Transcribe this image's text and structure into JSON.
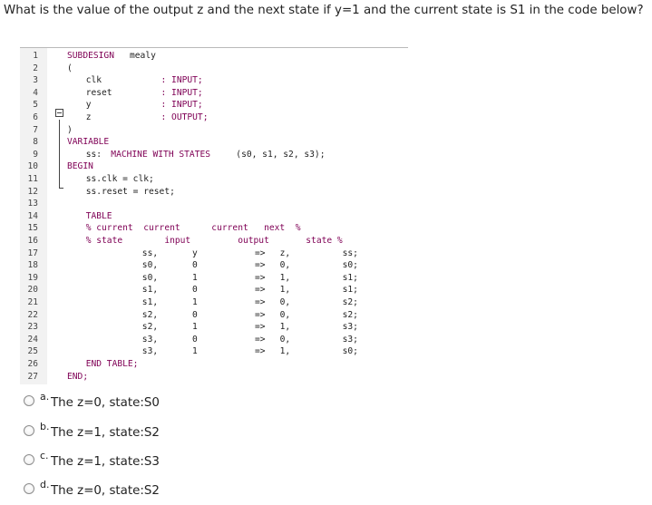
{
  "question": "What is the value of the output z and the next state if y=1 and the current state is S1 in the code below?",
  "code_lines": [
    {
      "no": "1",
      "tokens": [
        {
          "t": "SUBDESIGN",
          "c": "kw",
          "col": 0
        },
        {
          "t": "mealy",
          "c": "id",
          "col": 10
        }
      ]
    },
    {
      "no": "2",
      "tokens": [
        {
          "t": "(",
          "c": "id",
          "col": 0
        }
      ]
    },
    {
      "no": "3",
      "tokens": [
        {
          "t": "clk",
          "c": "id",
          "col": 3
        },
        {
          "t": ": INPUT;",
          "c": "kw",
          "col": 15
        }
      ]
    },
    {
      "no": "4",
      "tokens": [
        {
          "t": "reset",
          "c": "id",
          "col": 3
        },
        {
          "t": ": INPUT;",
          "c": "kw",
          "col": 15
        }
      ]
    },
    {
      "no": "5",
      "tokens": [
        {
          "t": "y",
          "c": "id",
          "col": 3
        },
        {
          "t": ": INPUT;",
          "c": "kw",
          "col": 15
        }
      ]
    },
    {
      "no": "6",
      "tokens": [
        {
          "t": "z",
          "c": "id",
          "col": 3
        },
        {
          "t": ": OUTPUT;",
          "c": "kw",
          "col": 15
        }
      ]
    },
    {
      "no": "7",
      "tokens": [
        {
          "t": ")",
          "c": "id",
          "col": 0
        }
      ]
    },
    {
      "no": "8",
      "tokens": [
        {
          "t": "VARIABLE",
          "c": "kw",
          "col": 0
        }
      ]
    },
    {
      "no": "9",
      "tokens": [
        {
          "t": "ss:",
          "c": "id",
          "col": 3
        },
        {
          "t": "MACHINE WITH STATES",
          "c": "kw",
          "col": 7
        },
        {
          "t": "(s0, s1, s2, s3);",
          "c": "id",
          "col": 27
        }
      ]
    },
    {
      "no": "10",
      "tokens": [
        {
          "t": "BEGIN",
          "c": "kw",
          "col": 0
        }
      ]
    },
    {
      "no": "11",
      "tokens": [
        {
          "t": "ss.clk = clk;",
          "c": "id",
          "col": 3
        }
      ]
    },
    {
      "no": "12",
      "tokens": [
        {
          "t": "ss.reset = reset;",
          "c": "id",
          "col": 3
        }
      ]
    },
    {
      "no": "13",
      "tokens": []
    },
    {
      "no": "14",
      "tokens": [
        {
          "t": "TABLE",
          "c": "kw",
          "col": 3
        }
      ]
    },
    {
      "no": "15",
      "tokens": [
        {
          "t": "% current  current      current   next  %",
          "c": "kw",
          "col": 3
        }
      ]
    },
    {
      "no": "16",
      "tokens": [
        {
          "t": "% state        input         output       state %",
          "c": "kw",
          "col": 3
        }
      ]
    },
    {
      "no": "17",
      "tokens": [
        {
          "t": "ss,",
          "c": "id",
          "col": 12
        },
        {
          "t": "y",
          "c": "id",
          "col": 20
        },
        {
          "t": "=>",
          "c": "id",
          "col": 30
        },
        {
          "t": "z,",
          "c": "id",
          "col": 34
        },
        {
          "t": "ss;",
          "c": "id",
          "col": 44
        }
      ]
    },
    {
      "no": "18",
      "tokens": [
        {
          "t": "s0,",
          "c": "id",
          "col": 12
        },
        {
          "t": "0",
          "c": "num",
          "col": 20
        },
        {
          "t": "=>",
          "c": "id",
          "col": 30
        },
        {
          "t": "0,",
          "c": "num",
          "col": 34
        },
        {
          "t": "s0;",
          "c": "id",
          "col": 44
        }
      ]
    },
    {
      "no": "19",
      "tokens": [
        {
          "t": "s0,",
          "c": "id",
          "col": 12
        },
        {
          "t": "1",
          "c": "num",
          "col": 20
        },
        {
          "t": "=>",
          "c": "id",
          "col": 30
        },
        {
          "t": "1,",
          "c": "num",
          "col": 34
        },
        {
          "t": "s1;",
          "c": "id",
          "col": 44
        }
      ]
    },
    {
      "no": "20",
      "tokens": [
        {
          "t": "s1,",
          "c": "id",
          "col": 12
        },
        {
          "t": "0",
          "c": "num",
          "col": 20
        },
        {
          "t": "=>",
          "c": "id",
          "col": 30
        },
        {
          "t": "1,",
          "c": "num",
          "col": 34
        },
        {
          "t": "s1;",
          "c": "id",
          "col": 44
        }
      ]
    },
    {
      "no": "21",
      "tokens": [
        {
          "t": "s1,",
          "c": "id",
          "col": 12
        },
        {
          "t": "1",
          "c": "num",
          "col": 20
        },
        {
          "t": "=>",
          "c": "id",
          "col": 30
        },
        {
          "t": "0,",
          "c": "num",
          "col": 34
        },
        {
          "t": "s2;",
          "c": "id",
          "col": 44
        }
      ]
    },
    {
      "no": "22",
      "tokens": [
        {
          "t": "s2,",
          "c": "id",
          "col": 12
        },
        {
          "t": "0",
          "c": "num",
          "col": 20
        },
        {
          "t": "=>",
          "c": "id",
          "col": 30
        },
        {
          "t": "0,",
          "c": "num",
          "col": 34
        },
        {
          "t": "s2;",
          "c": "id",
          "col": 44
        }
      ]
    },
    {
      "no": "23",
      "tokens": [
        {
          "t": "s2,",
          "c": "id",
          "col": 12
        },
        {
          "t": "1",
          "c": "num",
          "col": 20
        },
        {
          "t": "=>",
          "c": "id",
          "col": 30
        },
        {
          "t": "1,",
          "c": "num",
          "col": 34
        },
        {
          "t": "s3;",
          "c": "id",
          "col": 44
        }
      ]
    },
    {
      "no": "24",
      "tokens": [
        {
          "t": "s3,",
          "c": "id",
          "col": 12
        },
        {
          "t": "0",
          "c": "num",
          "col": 20
        },
        {
          "t": "=>",
          "c": "id",
          "col": 30
        },
        {
          "t": "0,",
          "c": "num",
          "col": 34
        },
        {
          "t": "s3;",
          "c": "id",
          "col": 44
        }
      ]
    },
    {
      "no": "25",
      "tokens": [
        {
          "t": "s3,",
          "c": "id",
          "col": 12
        },
        {
          "t": "1",
          "c": "num",
          "col": 20
        },
        {
          "t": "=>",
          "c": "id",
          "col": 30
        },
        {
          "t": "1,",
          "c": "num",
          "col": 34
        },
        {
          "t": "s0;",
          "c": "id",
          "col": 44
        }
      ]
    },
    {
      "no": "26",
      "tokens": [
        {
          "t": "END TABLE;",
          "c": "kw",
          "col": 3
        }
      ]
    },
    {
      "no": "27",
      "tokens": [
        {
          "t": "END;",
          "c": "kw",
          "col": 0
        }
      ]
    }
  ],
  "options": [
    {
      "letter": "a.",
      "text": "The z=0, state:S0"
    },
    {
      "letter": "b.",
      "text": "The z=1, state:S2"
    },
    {
      "letter": "c.",
      "text": "The z=1, state:S3"
    },
    {
      "letter": "d.",
      "text": "The z=0, state:S2"
    }
  ],
  "colors": {
    "keyword": "#7f0055",
    "gutter": "#f2f2f2",
    "text": "#222222"
  }
}
